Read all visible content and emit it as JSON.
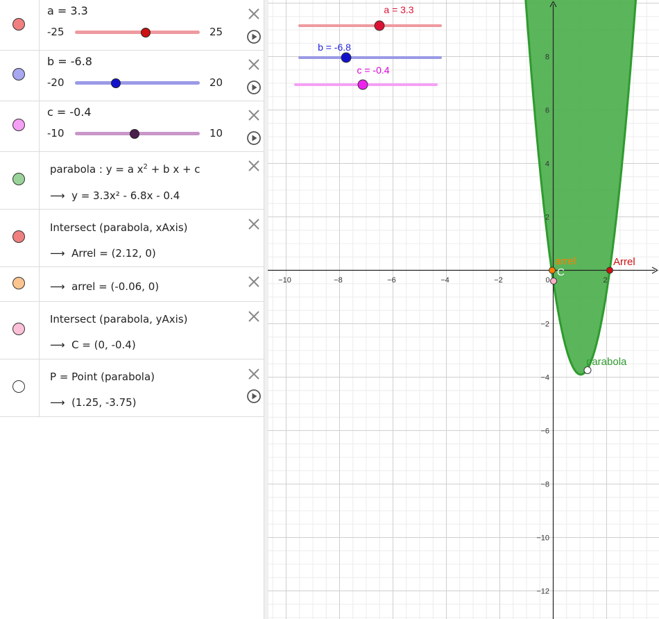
{
  "algebra": {
    "a": {
      "label": "a = 3.3",
      "min": "-25",
      "max": "25",
      "value": 3.3,
      "range": [
        -25,
        25
      ],
      "color": "#e8858f",
      "knob": "#cc1111"
    },
    "b": {
      "label": "b = -6.8",
      "min": "-20",
      "max": "20",
      "value": -6.8,
      "range": [
        -20,
        20
      ],
      "color": "#8f8fe0",
      "knob": "#1212cc"
    },
    "c": {
      "label": "c = -0.4",
      "min": "-10",
      "max": "10",
      "value": -0.4,
      "range": [
        -10,
        10
      ],
      "color": "#c896c8",
      "knob": "#4a1f4a"
    },
    "parabola": {
      "def_prefix": "parabola : y = a x",
      "def_exp": "2",
      "def_suffix": " + b x + c",
      "value": "y = 3.3x² - 6.8x - 0.4",
      "color": "#9ad39a"
    },
    "intersect_x": {
      "def": "Intersect (parabola, xAxis)",
      "value1": "Arrel = (2.12, 0)",
      "value2": "arrel = (-0.06, 0)",
      "color1": "#f08080",
      "color2": "#fcc590"
    },
    "intersect_y": {
      "def": "Intersect (parabola, yAxis)",
      "value": "C = (0, -0.4)",
      "color": "#fcc0d8"
    },
    "point": {
      "def": "P = Point (parabola)",
      "value": "(1.25, -3.75)",
      "color": "#ffffff"
    },
    "arrow": "⟶",
    "icons": {
      "close": "close-icon",
      "play": "play-icon"
    }
  },
  "graphics": {
    "slider_labels": {
      "a": "a = 3.3",
      "b": "b = -6.8",
      "c": "c = -0.4"
    },
    "x_ticks": [
      "−10",
      "−8",
      "−6",
      "−4",
      "−2",
      "0",
      "2"
    ],
    "y_ticks": [
      "8",
      "6",
      "4",
      "2",
      "−2",
      "−4",
      "−6",
      "−8",
      "−10",
      "−12"
    ],
    "point_labels": {
      "arrel_left": "arrel",
      "arrel_right": "Arrel",
      "c": "C",
      "parabola": "parabola"
    },
    "colors": {
      "fill": "#52b152",
      "stroke": "#2e9b2e",
      "axis": "#222222"
    }
  }
}
